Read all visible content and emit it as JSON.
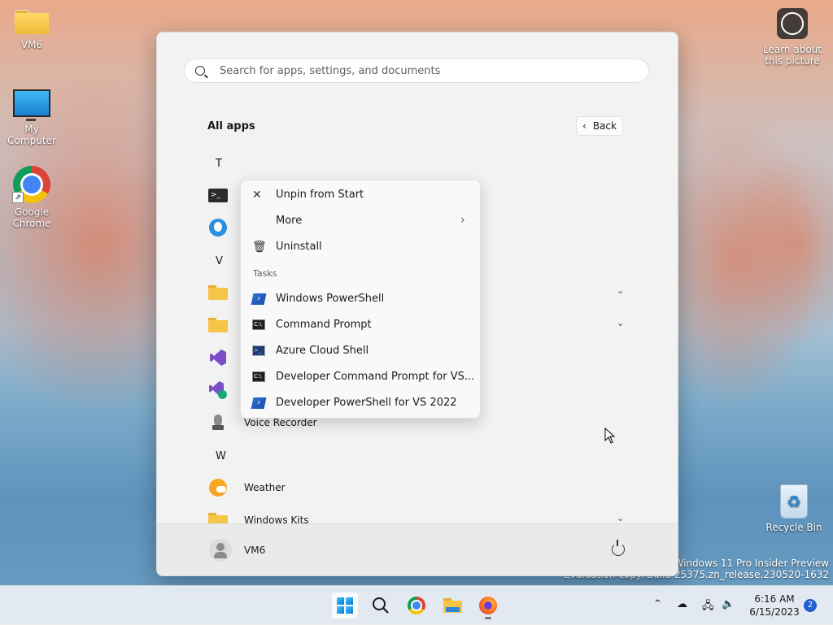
{
  "desktop": {
    "icons": [
      {
        "label": "VM6"
      },
      {
        "label": "My Computer"
      },
      {
        "label": "Google Chrome"
      }
    ],
    "learn_label": "Learn about this picture",
    "recycle_label": "Recycle Bin",
    "watermark_line1": "Windows 11 Pro Insider Preview",
    "watermark_line2": "Evaluation copy. Build 25375.zn_release.230520-1632"
  },
  "start_menu": {
    "search_placeholder": "Search for apps, settings, and documents",
    "heading": "All apps",
    "back_label": "Back",
    "letters": {
      "t": "T",
      "v": "V",
      "w": "W"
    },
    "apps": {
      "voice_recorder": "Voice Recorder",
      "weather": "Weather",
      "windows_kits": "Windows Kits"
    },
    "user_name": "VM6"
  },
  "context_menu": {
    "unpin": "Unpin from Start",
    "more": "More",
    "uninstall": "Uninstall",
    "tasks_heading": "Tasks",
    "tasks": [
      "Windows PowerShell",
      "Command Prompt",
      "Azure Cloud Shell",
      "Developer Command Prompt for VS...",
      "Developer PowerShell for VS 2022"
    ]
  },
  "taskbar": {
    "time": "6:16 AM",
    "date": "6/15/2023",
    "notification_count": "2"
  },
  "colors": {
    "accent": "#0078d4",
    "badge": "#1f5fcf"
  }
}
